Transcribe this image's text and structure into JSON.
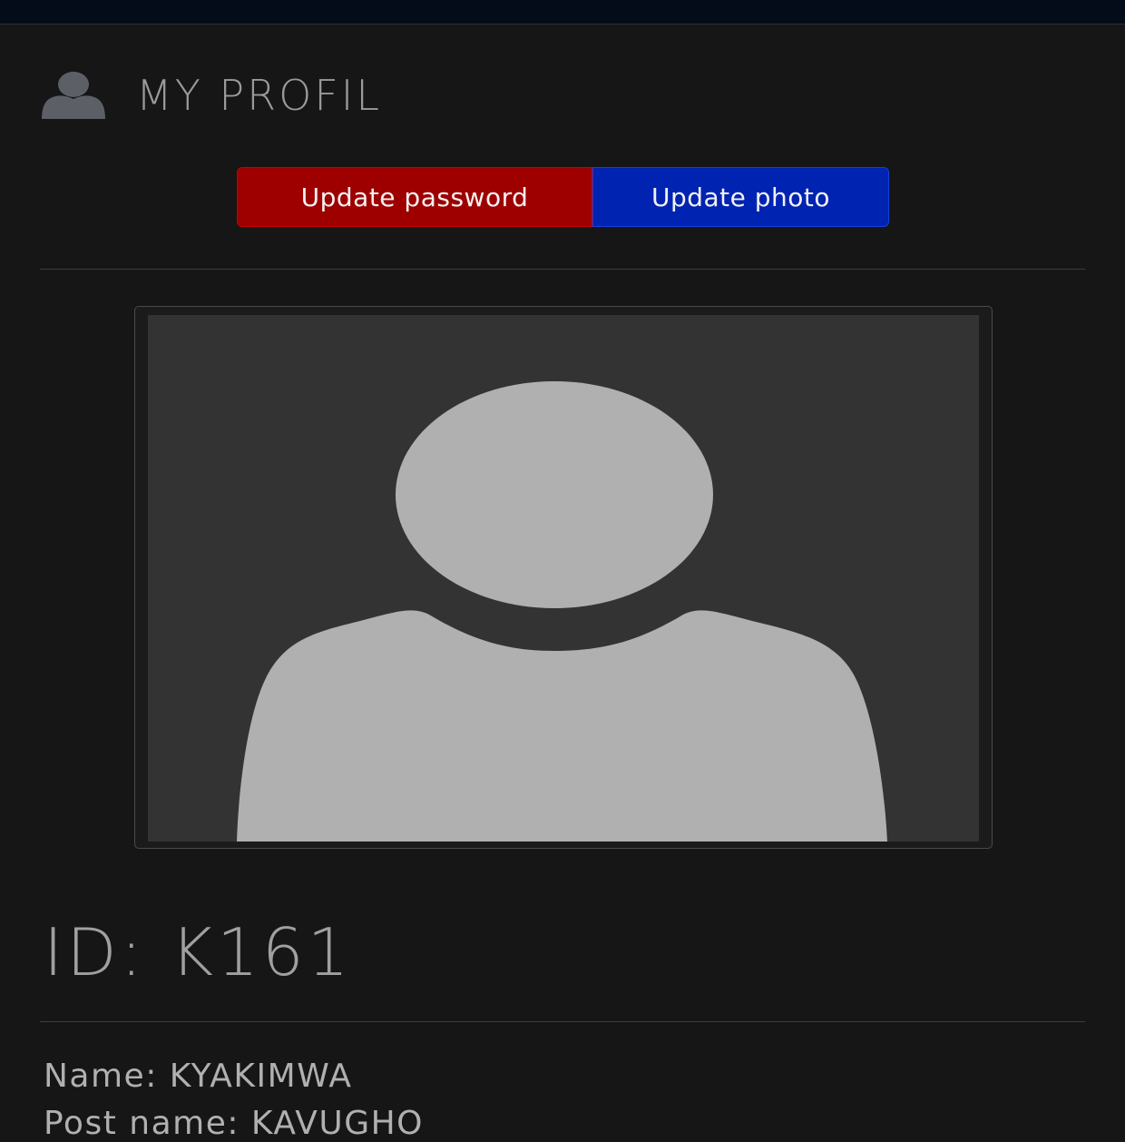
{
  "header": {
    "title": "MY PROFIL",
    "icon": "user-icon"
  },
  "actions": {
    "update_password": "Update password",
    "update_photo": "Update photo",
    "colors": {
      "update_password_bg": "#9e0000",
      "update_photo_bg": "#0023b1"
    }
  },
  "profile": {
    "photo": "default-avatar-placeholder",
    "id": "ID: K161",
    "name": "Name: KYAKIMWA",
    "post_name": "Post name: KAVUGHO"
  }
}
